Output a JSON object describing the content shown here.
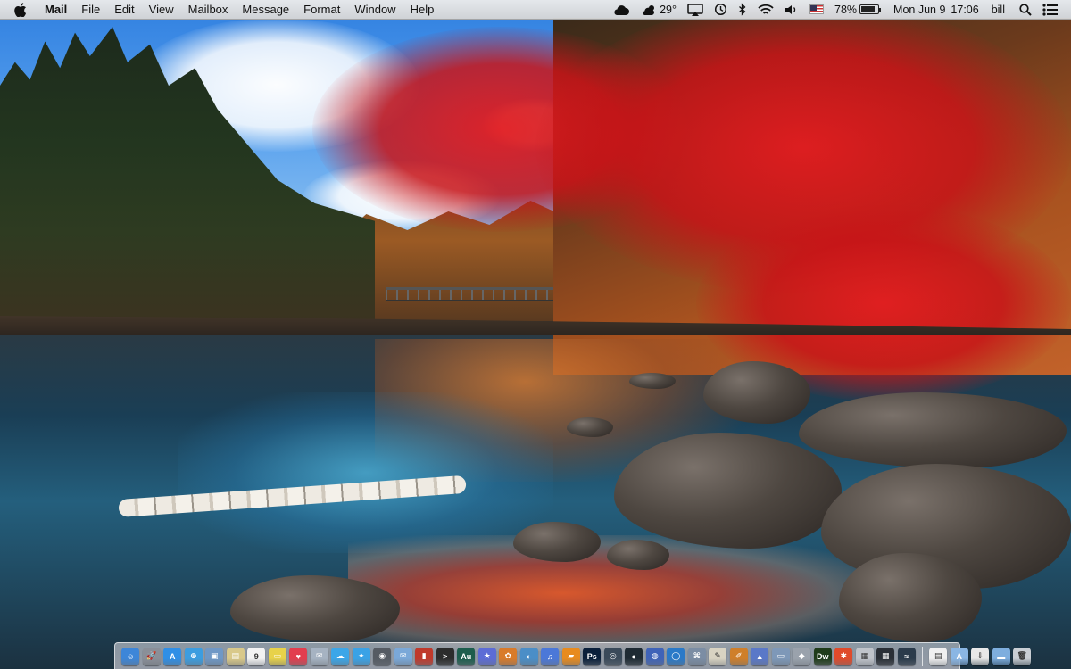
{
  "menubar": {
    "app_name": "Mail",
    "menus": [
      "File",
      "Edit",
      "View",
      "Mailbox",
      "Message",
      "Format",
      "Window",
      "Help"
    ],
    "status": {
      "weather_temp": "29°",
      "battery_percent": "78%",
      "battery_level": 0.78,
      "date": "Mon Jun 9",
      "time": "17:06",
      "user": "bill"
    }
  },
  "dock": {
    "apps": [
      {
        "icon": "finder-icon",
        "color": "#3d86d8",
        "glyph": "☺"
      },
      {
        "icon": "launchpad-icon",
        "color": "#8a8f98",
        "glyph": "🚀"
      },
      {
        "icon": "app-store-icon",
        "color": "#2f8fe6",
        "glyph": "A"
      },
      {
        "icon": "safari-icon",
        "color": "#3c9de0",
        "glyph": "⊕"
      },
      {
        "icon": "preview-icon",
        "color": "#6f98c6",
        "glyph": "▣"
      },
      {
        "icon": "notes-icon",
        "color": "#d9c98a",
        "glyph": "▤"
      },
      {
        "icon": "calendar-icon",
        "color": "#f3f3f3",
        "glyph": "9",
        "dark": true
      },
      {
        "icon": "stickies-icon",
        "color": "#e8d24a",
        "glyph": "▭"
      },
      {
        "icon": "pocket-icon",
        "color": "#e23e4e",
        "glyph": "♥"
      },
      {
        "icon": "messages-icon",
        "color": "#a6b3c2",
        "glyph": "✉"
      },
      {
        "icon": "chat-icon",
        "color": "#3ca6e8",
        "glyph": "☁"
      },
      {
        "icon": "twitter-icon",
        "color": "#3aa2e6",
        "glyph": "✦"
      },
      {
        "icon": "camera-icon",
        "color": "#555b63",
        "glyph": "◉"
      },
      {
        "icon": "mail-icon",
        "color": "#7aa8d8",
        "glyph": "✉"
      },
      {
        "icon": "photo-booth-icon",
        "color": "#c0392b",
        "glyph": "▮"
      },
      {
        "icon": "terminal-icon",
        "color": "#2c2c2c",
        "glyph": ">"
      },
      {
        "icon": "audition-icon",
        "color": "#1d5d4d",
        "glyph": "Au"
      },
      {
        "icon": "imovie-icon",
        "color": "#5c6cd6",
        "glyph": "★"
      },
      {
        "icon": "photos-icon",
        "color": "#d97b2a",
        "glyph": "✿"
      },
      {
        "icon": "image-capture-icon",
        "color": "#4b8ec7",
        "glyph": "◐"
      },
      {
        "icon": "itunes-icon",
        "color": "#4b78d8",
        "glyph": "♫"
      },
      {
        "icon": "ibooks-icon",
        "color": "#e88b1e",
        "glyph": "▰"
      },
      {
        "icon": "photoshop-icon",
        "color": "#0a1f3a",
        "glyph": "Ps"
      },
      {
        "icon": "camera-raw-icon",
        "color": "#3a4a5a",
        "glyph": "◎"
      },
      {
        "icon": "lens-icon",
        "color": "#1e2a33",
        "glyph": "●"
      },
      {
        "icon": "browser-icon",
        "color": "#3f63b8",
        "glyph": "◍"
      },
      {
        "icon": "globe-icon",
        "color": "#2a79c8",
        "glyph": "◯"
      },
      {
        "icon": "network-icon",
        "color": "#7b8da4",
        "glyph": "⌘"
      },
      {
        "icon": "script-editor-icon",
        "color": "#d8d3c2",
        "glyph": "✎",
        "dark": true
      },
      {
        "icon": "illustrator-icon",
        "color": "#cf7f2a",
        "glyph": "✐"
      },
      {
        "icon": "keynote-icon",
        "color": "#5a78c8",
        "glyph": "▲"
      },
      {
        "icon": "desktop-icon",
        "color": "#7e98b8",
        "glyph": "▭"
      },
      {
        "icon": "utility-icon",
        "color": "#9aa2ac",
        "glyph": "◆"
      },
      {
        "icon": "dreamweaver-icon",
        "color": "#1f3b1a",
        "glyph": "Dw"
      },
      {
        "icon": "spark-icon",
        "color": "#e04a2a",
        "glyph": "✱"
      },
      {
        "icon": "print-icon",
        "color": "#c0c4ca",
        "glyph": "▦",
        "dark": true
      },
      {
        "icon": "grid-icon",
        "color": "#2a2f36",
        "glyph": "▦"
      },
      {
        "icon": "activity-monitor-icon",
        "color": "#2b3b4b",
        "glyph": "≈"
      }
    ],
    "stack": [
      {
        "icon": "documents-folder-icon",
        "color": "#f0f0f0",
        "glyph": "▤",
        "dark": true
      },
      {
        "icon": "applications-folder-icon",
        "color": "#8ab6e4",
        "glyph": "A"
      },
      {
        "icon": "downloads-folder-icon",
        "color": "#e8e8e8",
        "glyph": "⇩",
        "dark": true
      },
      {
        "icon": "folder-icon",
        "color": "#7eaede",
        "glyph": "▬"
      },
      {
        "icon": "trash-icon",
        "color": "#c9ced4",
        "glyph": "🗑",
        "dark": true
      }
    ]
  }
}
